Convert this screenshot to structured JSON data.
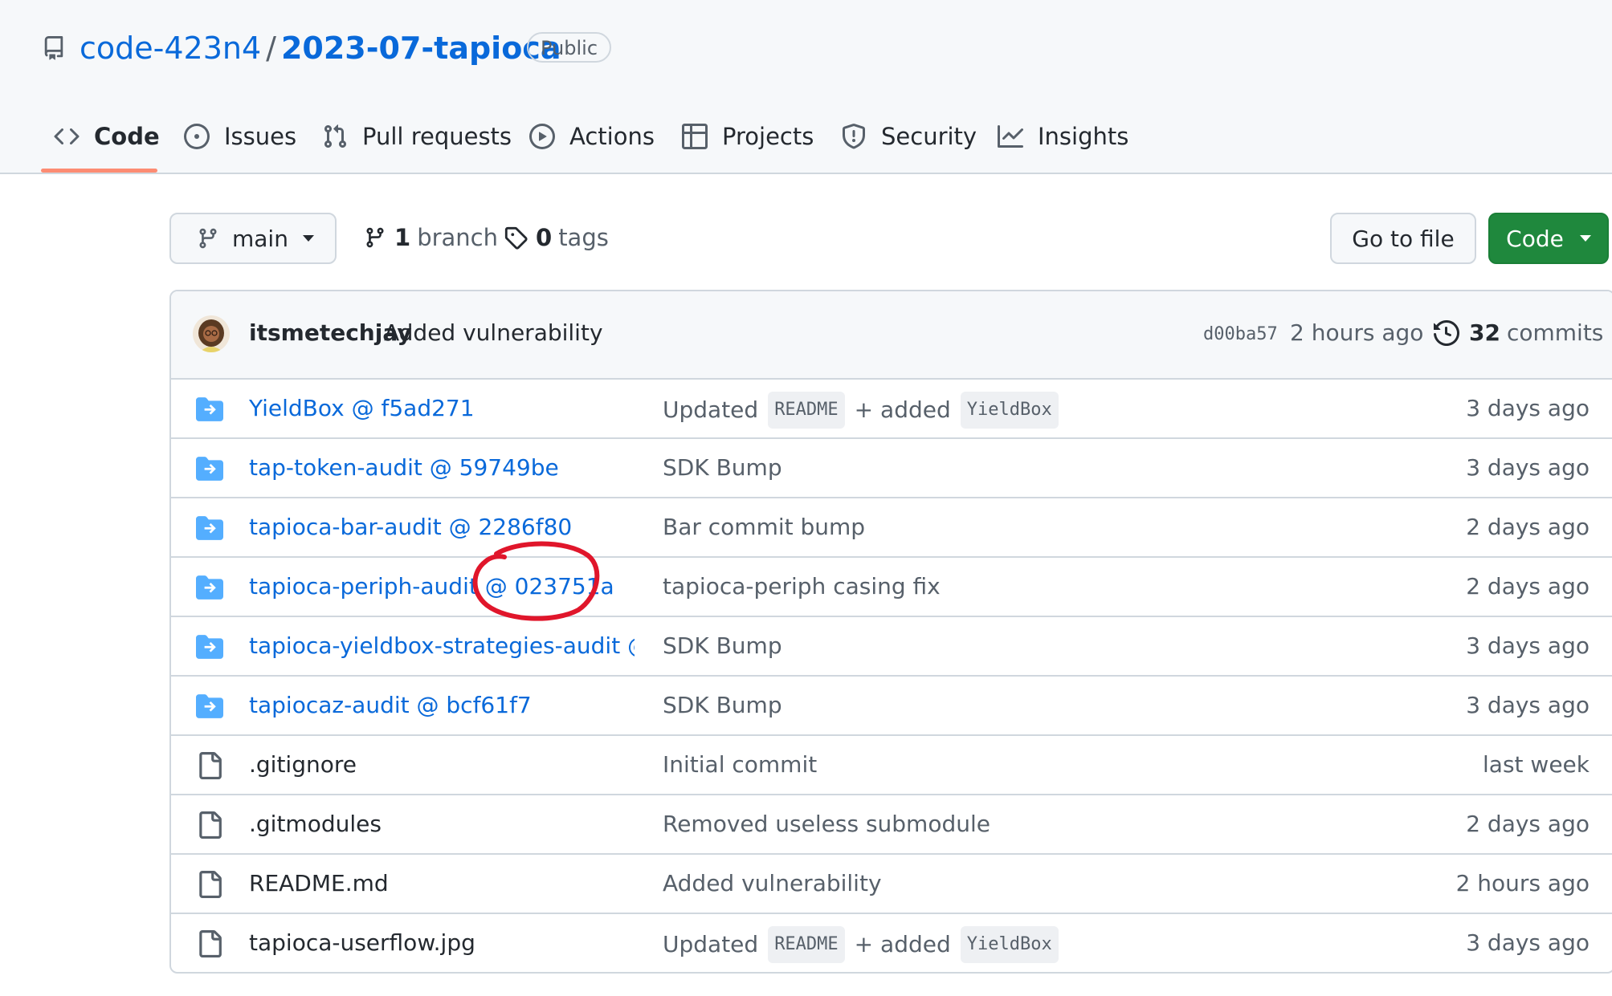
{
  "repo": {
    "owner": "code-423n4",
    "separator": "/",
    "name": "2023-07-tapioca",
    "visibility": "Public"
  },
  "tabs": [
    {
      "label": "Code",
      "icon": "code-icon",
      "selected": true
    },
    {
      "label": "Issues",
      "icon": "issue-opened-icon"
    },
    {
      "label": "Pull requests",
      "icon": "git-pull-request-icon"
    },
    {
      "label": "Actions",
      "icon": "play-icon"
    },
    {
      "label": "Projects",
      "icon": "table-icon"
    },
    {
      "label": "Security",
      "icon": "shield-icon"
    },
    {
      "label": "Insights",
      "icon": "graph-icon"
    }
  ],
  "toolbar": {
    "branch": "main",
    "branch_count": "1",
    "branch_label": "branch",
    "tag_count": "0",
    "tag_label": "tags",
    "go_to_file": "Go to file",
    "code_button": "Code"
  },
  "latest_commit": {
    "author": "itsmetechjay",
    "message": "Added vulnerability",
    "sha": "d00ba57",
    "time": "2 hours ago",
    "commit_count": "32",
    "commit_label": "commits"
  },
  "files": [
    {
      "type": "submodule",
      "name": "YieldBox @ f5ad271",
      "msg_parts": [
        "Updated",
        "README",
        "+ added",
        "YieldBox"
      ],
      "age": "3 days ago"
    },
    {
      "type": "submodule",
      "name": "tap-token-audit @ 59749be",
      "msg_parts": [
        "SDK Bump"
      ],
      "age": "3 days ago"
    },
    {
      "type": "submodule",
      "name": "tapioca-bar-audit @ 2286f80",
      "msg_parts": [
        "Bar commit bump"
      ],
      "age": "2 days ago"
    },
    {
      "type": "submodule",
      "name": "tapioca-periph-audit @ 023751a",
      "msg_parts": [
        "tapioca-periph casing fix"
      ],
      "age": "2 days ago"
    },
    {
      "type": "submodule",
      "name": "tapioca-yieldbox-strategies-audit @ …",
      "msg_parts": [
        "SDK Bump"
      ],
      "age": "3 days ago"
    },
    {
      "type": "submodule",
      "name": "tapiocaz-audit @ bcf61f7",
      "msg_parts": [
        "SDK Bump"
      ],
      "age": "3 days ago"
    },
    {
      "type": "file",
      "name": ".gitignore",
      "msg_parts": [
        "Initial commit"
      ],
      "age": "last week"
    },
    {
      "type": "file",
      "name": ".gitmodules",
      "msg_parts": [
        "Removed useless submodule"
      ],
      "age": "2 days ago"
    },
    {
      "type": "file",
      "name": "README.md",
      "msg_parts": [
        "Added vulnerability"
      ],
      "age": "2 hours ago"
    },
    {
      "type": "file",
      "name": "tapioca-userflow.jpg",
      "msg_parts": [
        "Updated",
        "README",
        "+ added",
        "YieldBox"
      ],
      "age": "3 days ago"
    }
  ],
  "colors": {
    "link": "#0969da",
    "primary_button": "#1f883d",
    "tab_underline": "#fd8c73",
    "annotation": "#e0162b"
  }
}
